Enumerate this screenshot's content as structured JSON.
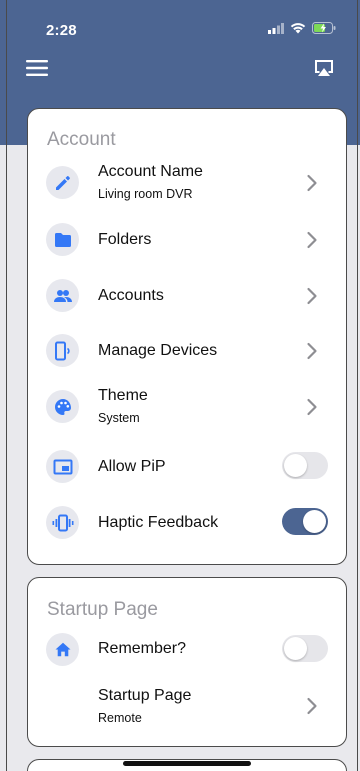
{
  "status_bar": {
    "time": "2:28"
  },
  "colors": {
    "header": "#4c6592",
    "accent": "#3478f6",
    "toggle_on": "#4c6592"
  },
  "account_section": {
    "title": "Account",
    "items": [
      {
        "title": "Account Name",
        "subtitle": "Living room DVR",
        "icon": "pencil-icon",
        "control": "chevron"
      },
      {
        "title": "Folders",
        "icon": "folder-icon",
        "control": "chevron"
      },
      {
        "title": "Accounts",
        "icon": "people-icon",
        "control": "chevron"
      },
      {
        "title": "Manage Devices",
        "icon": "device-icon",
        "control": "chevron"
      },
      {
        "title": "Theme",
        "subtitle": "System",
        "icon": "palette-icon",
        "control": "chevron"
      },
      {
        "title": "Allow PiP",
        "icon": "pip-icon",
        "control": "toggle",
        "value": false
      },
      {
        "title": "Haptic Feedback",
        "icon": "vibration-icon",
        "control": "toggle",
        "value": true
      }
    ]
  },
  "startup_section": {
    "title": "Startup Page",
    "items": [
      {
        "title": "Remember?",
        "icon": "home-icon",
        "control": "toggle",
        "value": false
      },
      {
        "title": "Startup Page",
        "subtitle": "Remote",
        "control": "chevron"
      }
    ]
  }
}
